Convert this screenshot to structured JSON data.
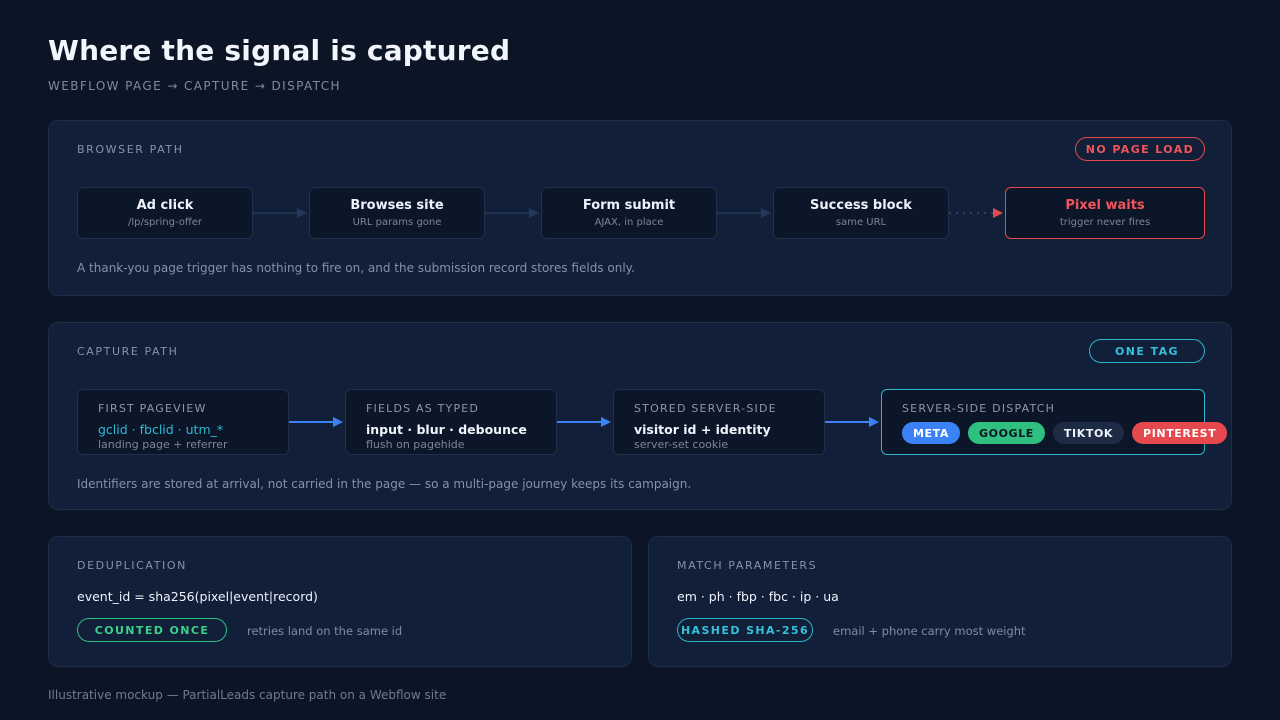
{
  "header": {
    "title": "Where the signal is captured",
    "subtitle": "WEBFLOW PAGE → CAPTURE → DISPATCH"
  },
  "browser_path": {
    "label": "BROWSER PATH",
    "badge": "NO PAGE LOAD",
    "steps": [
      {
        "title": "Ad click",
        "sub": "/lp/spring-offer"
      },
      {
        "title": "Browses site",
        "sub": "URL params gone"
      },
      {
        "title": "Form submit",
        "sub": "AJAX, in place"
      },
      {
        "title": "Success block",
        "sub": "same URL"
      },
      {
        "title": "Pixel waits",
        "sub": "trigger never fires"
      }
    ],
    "note": "A thank-you page trigger has nothing to fire on, and the submission record stores fields only."
  },
  "capture_path": {
    "label": "CAPTURE PATH",
    "badge": "ONE TAG",
    "steps": [
      {
        "label": "FIRST PAGEVIEW",
        "main": "gclid · fbclid · utm_*",
        "sub": "landing page + referrer"
      },
      {
        "label": "FIELDS AS TYPED",
        "main": "input · blur · debounce",
        "sub": "flush on pagehide"
      },
      {
        "label": "STORED SERVER-SIDE",
        "main": "visitor id + identity",
        "sub": "server-set cookie"
      },
      {
        "label": "SERVER-SIDE DISPATCH"
      }
    ],
    "destinations": [
      {
        "name": "META",
        "bg": "#3b82f6",
        "fg": "#ffffff"
      },
      {
        "name": "GOOGLE",
        "bg": "#2fbf7f",
        "fg": "#0b1526"
      },
      {
        "name": "TIKTOK",
        "bg": "#1e2b45",
        "fg": "#eef3fb"
      },
      {
        "name": "PINTEREST",
        "bg": "#e5484d",
        "fg": "#ffffff"
      }
    ],
    "note": "Identifiers are stored at arrival, not carried in the page — so a multi-page journey keeps its campaign."
  },
  "deduplication": {
    "label": "DEDUPLICATION",
    "formula": "event_id = sha256(pixel|event|record)",
    "badge": "COUNTED ONCE",
    "note": "retries land on the same id"
  },
  "match_parameters": {
    "label": "MATCH PARAMETERS",
    "params": "em · ph · fbp · fbc · ip · ua",
    "badge": "HASHED SHA-256",
    "note": "email + phone carry most weight"
  },
  "footer": "Illustrative mockup — PartialLeads capture path on a Webflow site",
  "colors": {
    "alert": "#e5484d",
    "accent_cyan": "#2eb4cc",
    "accent_green": "#2fbf7f",
    "arrow_blue": "#3b82f6"
  }
}
